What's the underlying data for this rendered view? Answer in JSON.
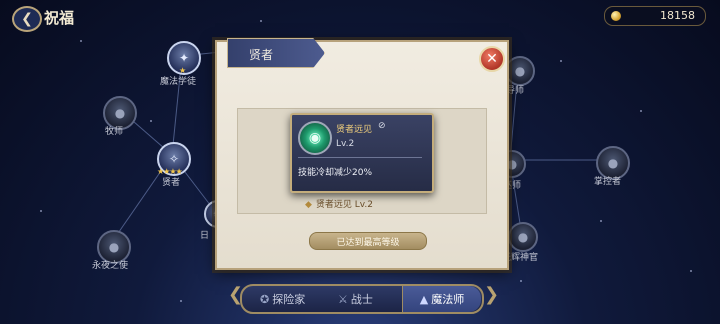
{
  "header": {
    "back_icon": "back-arrow-icon",
    "title": "祝福",
    "currency": {
      "icon": "coin-icon",
      "value": "18158"
    }
  },
  "skill_tree": {
    "nodes": [
      {
        "id": "magic-apprentice",
        "label": "魔法学徒",
        "stars": "★"
      },
      {
        "id": "priest",
        "label": "牧师"
      },
      {
        "id": "sage",
        "label": "贤者",
        "stars": "★★★★"
      },
      {
        "id": "day",
        "label": "日"
      },
      {
        "id": "eternal-night",
        "label": "永夜之使"
      },
      {
        "id": "mentor",
        "label": "导师"
      },
      {
        "id": "shaman",
        "label": "巫师"
      },
      {
        "id": "controller",
        "label": "掌控者"
      },
      {
        "id": "radiance",
        "label": "光辉神官"
      }
    ]
  },
  "dialog": {
    "title": "贤者",
    "close_icon": "close-icon",
    "skill_line": "贤者远见   Lv.2",
    "max_level_button": "已达到最高等级"
  },
  "tooltip": {
    "skill_name": "贤者远见",
    "edit_icon": "edit-icon",
    "level": "Lv.2",
    "description": "技能冷却减少20%"
  },
  "tabs": [
    {
      "label": "探险家",
      "icon": "compass-icon"
    },
    {
      "label": "战士",
      "icon": "sword-icon"
    },
    {
      "label": "魔法师",
      "icon": "wizard-hat-icon",
      "active": true
    }
  ],
  "colors": {
    "accent_gold": "#c4ad7c",
    "panel": "#e4ddce",
    "tooltip_bg": "#2c3352",
    "active_tab": "#3f4f8c"
  }
}
